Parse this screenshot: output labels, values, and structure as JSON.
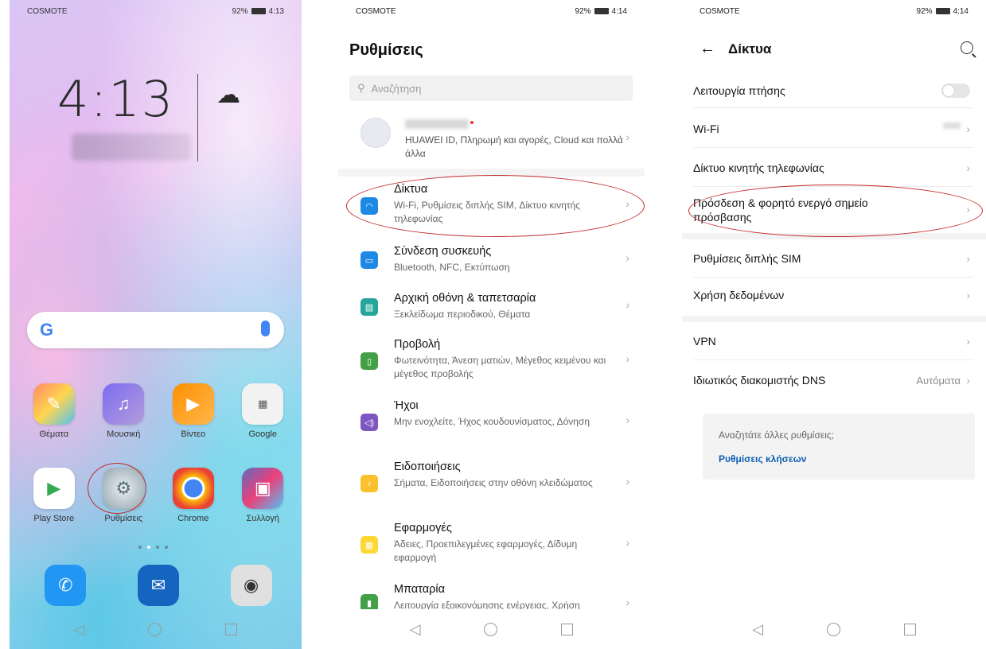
{
  "home": {
    "carrier": "COSMOTE",
    "battery": "92%",
    "time": "4:13",
    "clock": "4:13",
    "apps_row1": [
      {
        "label": "Θέματα",
        "icon": "themes-icon"
      },
      {
        "label": "Μουσική",
        "icon": "music-icon"
      },
      {
        "label": "Βίντεο",
        "icon": "video-icon"
      },
      {
        "label": "Google",
        "icon": "google-folder-icon"
      }
    ],
    "apps_row2": [
      {
        "label": "Play Store",
        "icon": "play-store-icon"
      },
      {
        "label": "Ρυθμίσεις",
        "icon": "settings-icon"
      },
      {
        "label": "Chrome",
        "icon": "chrome-icon"
      },
      {
        "label": "Συλλογή",
        "icon": "gallery-icon"
      }
    ]
  },
  "settings": {
    "carrier": "COSMOTE",
    "battery": "92%",
    "time": "4:14",
    "title": "Ρυθμίσεις",
    "search_placeholder": "Αναζήτηση",
    "account_sub": "HUAWEI ID, Πληρωμή και αγορές, Cloud και πολλά άλλα",
    "items": [
      {
        "title": "Δίκτυα",
        "sub": "Wi-Fi, Ρυθμίσεις διπλής SIM, Δίκτυο κινητής τηλεφωνίας",
        "color": "#1e88e5"
      },
      {
        "title": "Σύνδεση συσκευής",
        "sub": "Bluetooth, NFC, Εκτύπωση",
        "color": "#1e88e5"
      },
      {
        "title": "Αρχική οθόνη & ταπετσαρία",
        "sub": "Ξεκλείδωμα περιοδικού, Θέματα",
        "color": "#26a69a"
      },
      {
        "title": "Προβολή",
        "sub": "Φωτεινότητα, Άνεση ματιών, Μέγεθος κειμένου και μέγεθος προβολής",
        "color": "#43a047"
      },
      {
        "title": "Ήχοι",
        "sub": "Μην ενοχλείτε, Ήχος κουδουνίσματος, Δόνηση",
        "color": "#7e57c2"
      },
      {
        "title": "Ειδοποιήσεις",
        "sub": "Σήματα, Ειδοποιήσεις στην οθόνη κλειδώματος",
        "color": "#fbc02d"
      },
      {
        "title": "Εφαρμογές",
        "sub": "Άδειες, Προεπιλεγμένες εφαρμογές, Δίδυμη εφαρμογή",
        "color": "#fdd835"
      },
      {
        "title": "Μπαταρία",
        "sub": "Λειτουργία εξοικονόμησης ενέργειας, Χρήση μπαταρίας",
        "color": "#43a047"
      }
    ]
  },
  "networks": {
    "carrier": "COSMOTE",
    "battery": "92%",
    "time": "4:14",
    "title": "Δίκτυα",
    "rows": [
      {
        "label": "Λειτουργία πτήσης"
      },
      {
        "label": "Wi-Fi"
      },
      {
        "label": "Δίκτυο κινητής τηλεφωνίας"
      },
      {
        "label": "Πρόσδεση & φορητό ενεργό σημείο πρόσβασης"
      },
      {
        "label": "Ρυθμίσεις διπλής SIM"
      },
      {
        "label": "Χρήση δεδομένων"
      },
      {
        "label": "VPN"
      },
      {
        "label": "Ιδιωτικός διακομιστής DNS",
        "value": "Αυτόματα"
      }
    ],
    "suggest_question": "Αναζητάτε άλλες ρυθμίσεις;",
    "suggest_link": "Ρυθμίσεις κλήσεων"
  }
}
